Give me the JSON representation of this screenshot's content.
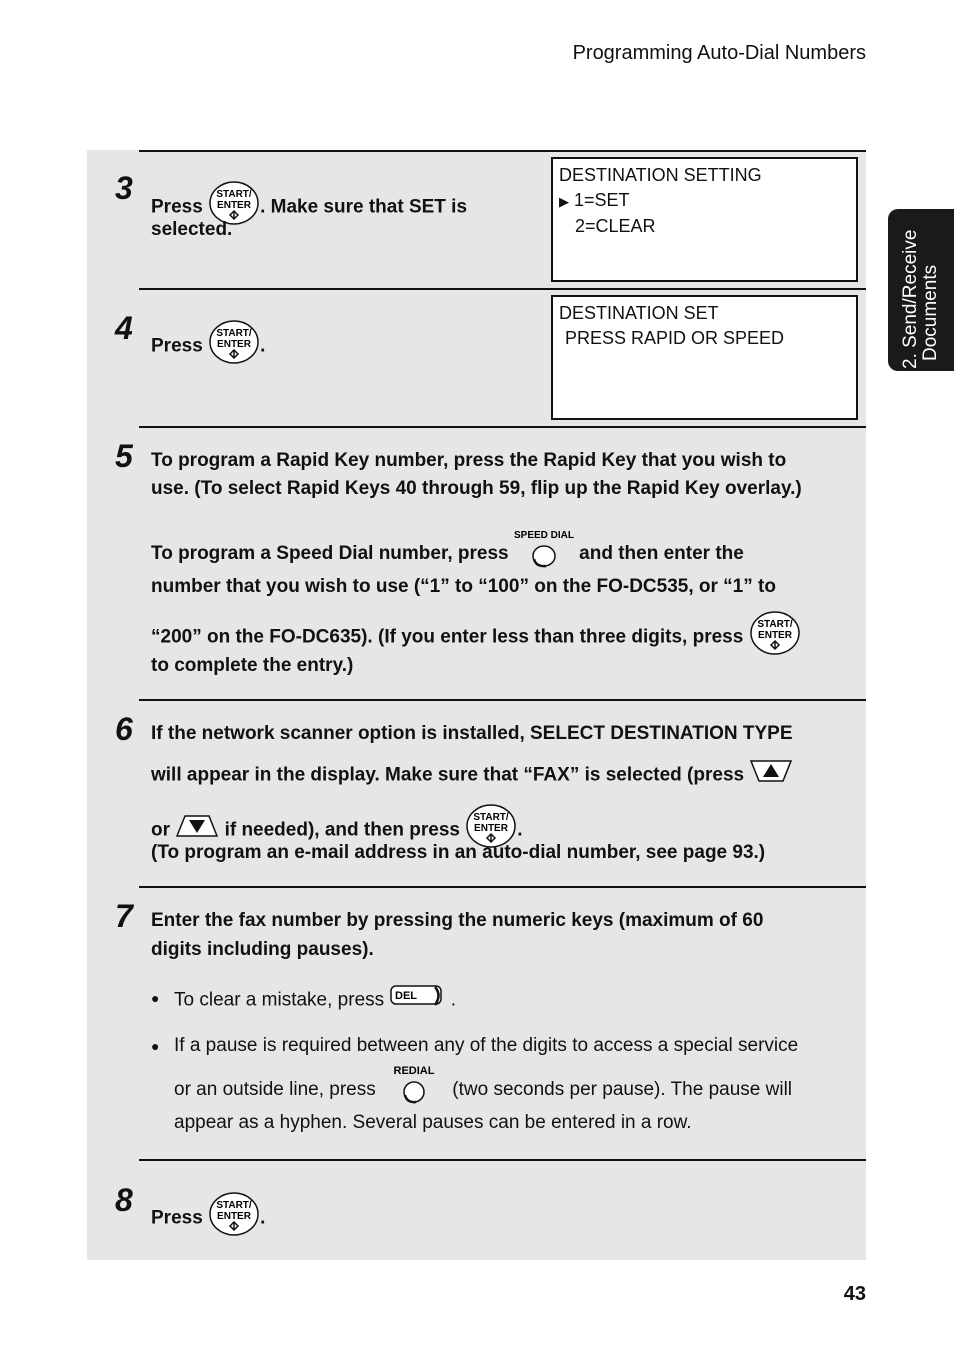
{
  "header": {
    "title": "Programming Auto-Dial Numbers"
  },
  "side_tab": {
    "line1": "2. Send/Receive",
    "line2": "Documents"
  },
  "keys": {
    "start_enter_top": "START/",
    "start_enter_bottom": "ENTER",
    "speed_dial": "SPEED DIAL",
    "redial": "REDIAL",
    "del": "DEL"
  },
  "steps": {
    "s3": {
      "num": "3",
      "press": "Press",
      "after": ". Make sure that SET is",
      "line2": "selected."
    },
    "s3_lcd": {
      "line1": "DESTINATION SETTING",
      "line2": "1=SET",
      "line3": "2=CLEAR"
    },
    "s4": {
      "num": "4",
      "press": "Press",
      "after": "."
    },
    "s4_lcd": {
      "line1": "DESTINATION SET",
      "line2": "PRESS RAPID OR SPEED"
    },
    "s5": {
      "num": "5",
      "p1_line1": "To program a Rapid Key number, press the Rapid Key that you wish to",
      "p1_line2": "use. (To select Rapid Keys 40 through 59, flip up the Rapid Key overlay.)",
      "p2_a": "To program a Speed Dial number, press",
      "p2_b": "and then enter the",
      "p2_line2": "number that you wish to use (“1” to “100” on the FO-DC535, or “1” to",
      "p2_line3": "“200” on the FO-DC635). (If you enter less than three digits, press",
      "p2_line4": "to complete the entry.)"
    },
    "s6": {
      "num": "6",
      "line1": "If the network scanner option is installed, SELECT DESTINATION TYPE",
      "line2": "will appear in the display. Make sure that “FAX” is selected (press",
      "line3_a": "or",
      "line3_b": "if needed), and then press",
      "line3_c": ".",
      "line4": "(To program an e-mail address in an auto-dial number, see page 93.)"
    },
    "s7": {
      "num": "7",
      "line1": "Enter the fax number by pressing the numeric keys (maximum of 60",
      "line2": "digits including pauses).",
      "b1_a": "To clear a mistake, press",
      "b1_b": ".",
      "b2_line1": "If a pause is required between any of the digits to access a special service",
      "b2_a": "or an outside line, press",
      "b2_b": "(two seconds per pause). The pause will",
      "b2_line3": "appear as a hyphen. Several pauses can be entered in a row."
    },
    "s8": {
      "num": "8",
      "press": "Press",
      "after": "."
    }
  },
  "footer": {
    "page_number": "43"
  }
}
